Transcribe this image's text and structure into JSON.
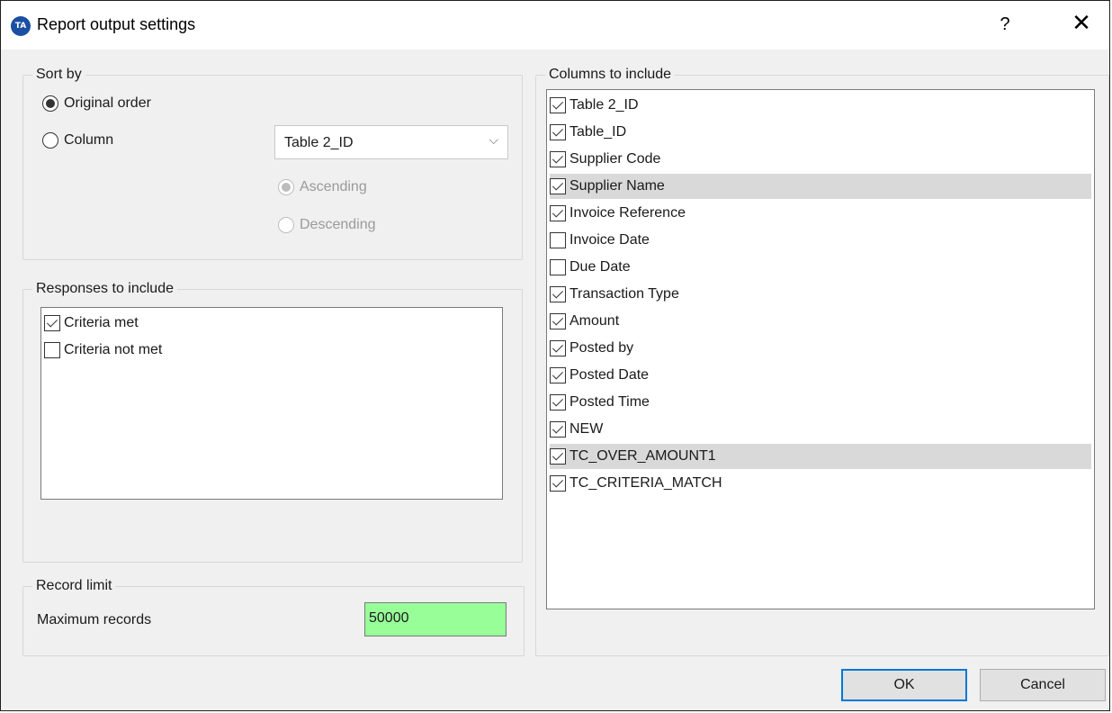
{
  "window": {
    "title": "Report output settings",
    "icon_text": "TA",
    "help_glyph": "?",
    "close_glyph": "✕"
  },
  "sort_by": {
    "group_label": "Sort by",
    "original_order_label": "Original order",
    "original_order_selected": true,
    "column_label": "Column",
    "column_selected": false,
    "column_dropdown_value": "Table 2_ID",
    "ascending_label": "Ascending",
    "ascending_selected": true,
    "descending_label": "Descending",
    "descending_selected": false
  },
  "responses": {
    "group_label": "Responses to include",
    "items": [
      {
        "label": "Criteria met",
        "checked": true
      },
      {
        "label": "Criteria not met",
        "checked": false
      }
    ]
  },
  "record_limit": {
    "group_label": "Record limit",
    "max_records_label": "Maximum records",
    "max_records_value": "50000",
    "input_color": "#98ff98"
  },
  "columns": {
    "group_label": "Columns to include",
    "items": [
      {
        "label": "Table 2_ID",
        "checked": true,
        "selected": false
      },
      {
        "label": "Table_ID",
        "checked": true,
        "selected": false
      },
      {
        "label": "Supplier Code",
        "checked": true,
        "selected": false
      },
      {
        "label": "Supplier Name",
        "checked": true,
        "selected": true
      },
      {
        "label": "Invoice Reference",
        "checked": true,
        "selected": false
      },
      {
        "label": "Invoice Date",
        "checked": false,
        "selected": false
      },
      {
        "label": "Due Date",
        "checked": false,
        "selected": false
      },
      {
        "label": "Transaction Type",
        "checked": true,
        "selected": false
      },
      {
        "label": "Amount",
        "checked": true,
        "selected": false
      },
      {
        "label": "Posted by",
        "checked": true,
        "selected": false
      },
      {
        "label": "Posted Date",
        "checked": true,
        "selected": false
      },
      {
        "label": "Posted Time",
        "checked": true,
        "selected": false
      },
      {
        "label": "NEW",
        "checked": true,
        "selected": false
      },
      {
        "label": "TC_OVER_AMOUNT1",
        "checked": true,
        "selected": true
      },
      {
        "label": "TC_CRITERIA_MATCH",
        "checked": true,
        "selected": false
      }
    ]
  },
  "buttons": {
    "ok_label": "OK",
    "cancel_label": "Cancel"
  },
  "colors": {
    "accent": "#0078d7",
    "selection": "#d9d9d9",
    "icon_bg": "#1b4fa3"
  }
}
